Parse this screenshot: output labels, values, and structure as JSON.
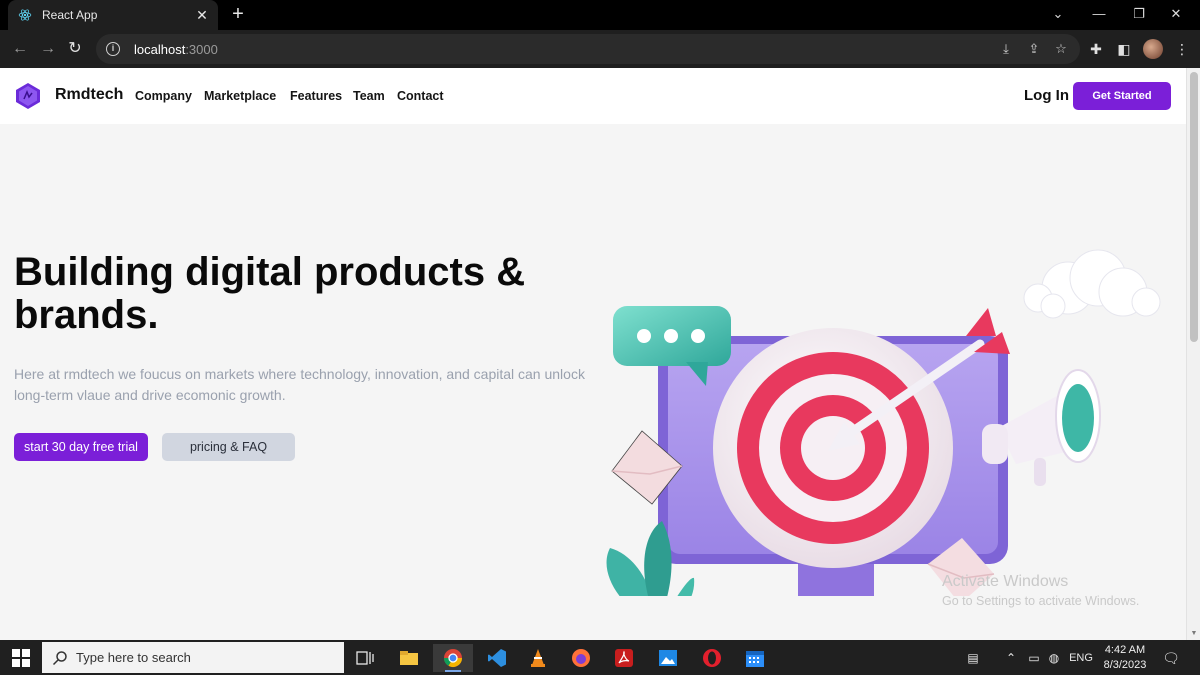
{
  "browser": {
    "tab_title": "React App",
    "tab_close": "✕",
    "new_tab": "+",
    "url_host": "localhost",
    "url_port": ":3000"
  },
  "site": {
    "brand": "Rmdtech",
    "nav": [
      "Company",
      "Marketplace",
      "Features",
      "Team",
      "Contact"
    ],
    "login": "Log In",
    "cta": "Get Started"
  },
  "hero": {
    "title_line1": "Building digital products &",
    "title_line2": "brands.",
    "text_line1": "Here at rmdtech we foucus on markets where technology, innovation, and capital can unlock",
    "text_line2": "long-term vlaue and drive ecomonic growth.",
    "primary_button": "start 30 day free trial",
    "secondary_button": "pricing & FAQ"
  },
  "watermark": {
    "title": "Activate Windows",
    "subtitle": "Go to Settings to activate Windows."
  },
  "taskbar": {
    "search_placeholder": "Type here to search",
    "language": "ENG",
    "time": "4:42 AM",
    "date": "8/3/2023"
  },
  "colors": {
    "accent": "#7b1fd8",
    "secondary_button": "#d1d6e0",
    "hero_text": "#9aa1ae",
    "page_background": "#f5f5f5"
  },
  "icons": [
    "react-favicon-icon",
    "back-arrow-icon",
    "forward-arrow-icon",
    "reload-icon",
    "info-icon",
    "install-icon",
    "share-icon",
    "star-icon",
    "extensions-icon",
    "sidebar-icon",
    "menu-icon",
    "windows-start-icon",
    "search-icon",
    "task-view-icon",
    "file-explorer-icon",
    "chrome-icon",
    "vscode-icon",
    "vlc-icon",
    "firefox-icon",
    "acrobat-icon",
    "photos-icon",
    "opera-icon",
    "calendar-icon",
    "network-icon",
    "volume-icon",
    "notification-icon"
  ]
}
